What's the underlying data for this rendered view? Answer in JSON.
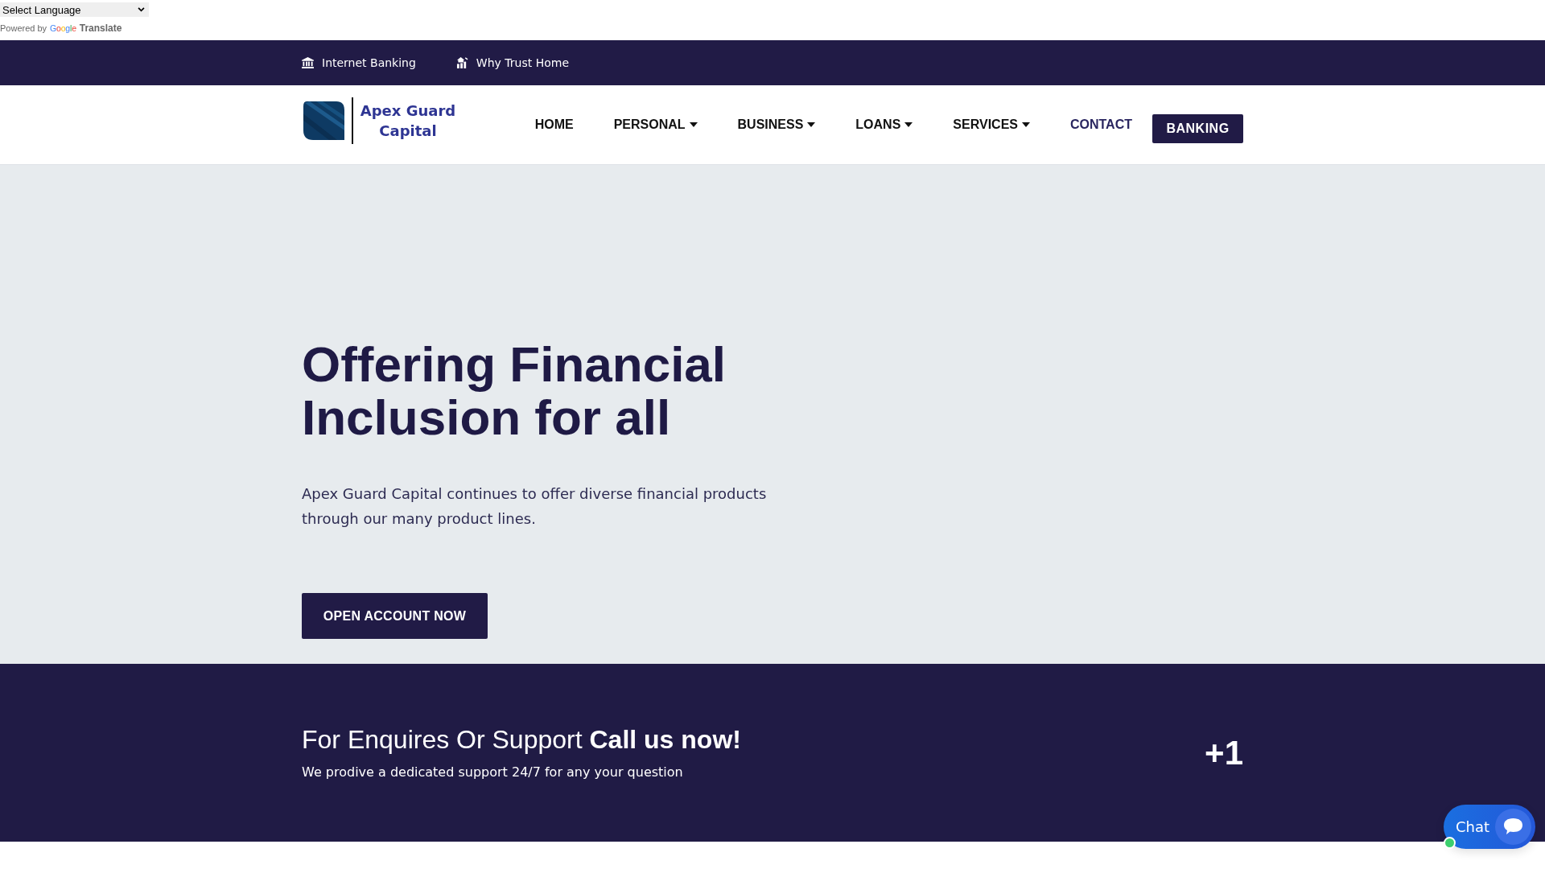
{
  "translate_widget": {
    "language_select": {
      "value": "Select Language"
    },
    "powered_by": "Powered by",
    "brand": "Google",
    "link": "Translate"
  },
  "top_bar": {
    "links": [
      {
        "label": "Internet Banking"
      },
      {
        "label": "Why Trust Home"
      }
    ]
  },
  "header": {
    "logo": {
      "name": "Apex Guard Capital"
    },
    "nav": [
      {
        "label": "HOME",
        "dropdown": false,
        "selected": false
      },
      {
        "label": "PERSONAL",
        "dropdown": true,
        "selected": false
      },
      {
        "label": "BUSINESS",
        "dropdown": true,
        "selected": false
      },
      {
        "label": "LOANS",
        "dropdown": true,
        "selected": false
      },
      {
        "label": "SERVICES",
        "dropdown": true,
        "selected": false
      },
      {
        "label": "CONTACT",
        "dropdown": false,
        "selected": true
      }
    ],
    "banking_button": "BANKING"
  },
  "hero": {
    "title": "Offering Financial Inclusion for all",
    "text": "Apex Guard Capital continues to offer diverse financial products through our many product lines.",
    "button": "OPEN ACCOUNT NOW"
  },
  "support_band": {
    "heading": "For Enquires Or Support **Call us now!**",
    "text": "We prodive a dedicated support 24/7 for any your question",
    "phone": "+1"
  },
  "chat_widget": {
    "label": "Chat",
    "online": true
  }
}
